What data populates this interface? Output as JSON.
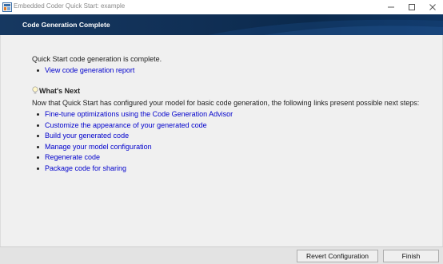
{
  "window": {
    "title": "Embedded Coder Quick Start: example",
    "icons": {
      "app": "matlab-app-icon",
      "minimize": "minimize-icon",
      "maximize": "maximize-icon",
      "close": "close-icon"
    }
  },
  "banner": {
    "title": "Code Generation Complete"
  },
  "content": {
    "status_message": "Quick Start code generation is complete.",
    "report_link": "View code generation report",
    "whats_next": {
      "icon": "lightbulb-icon",
      "heading": "What's Next",
      "intro": "Now that Quick Start has configured your model for basic code generation, the following links present possible next steps:",
      "links": [
        "Fine-tune optimizations using the Code Generation Advisor",
        "Customize the appearance of your generated code",
        "Build your generated code",
        "Manage your model configuration",
        "Regenerate code",
        "Package code for sharing"
      ]
    }
  },
  "footer": {
    "revert_label": "Revert Configuration",
    "finish_label": "Finish"
  },
  "colors": {
    "banner": "#102f55",
    "link": "#0000cc",
    "background": "#f0f0f0"
  }
}
